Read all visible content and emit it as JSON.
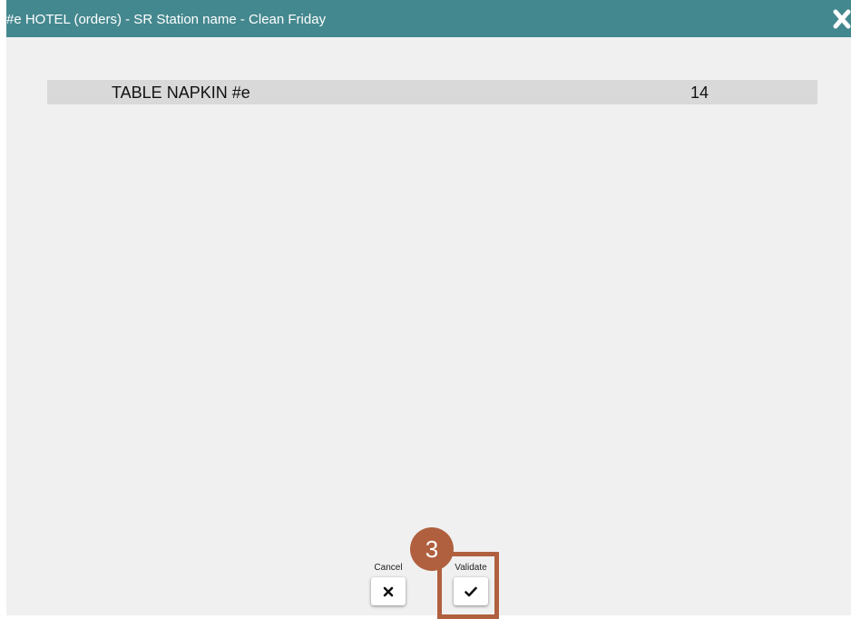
{
  "dialog": {
    "title": "#e HOTEL (orders) - SR Station name - Clean Friday",
    "close_icon": "close-icon",
    "header_color": "#44888f"
  },
  "items": [
    {
      "name": "TABLE NAPKIN #e",
      "quantity": "14"
    }
  ],
  "actions": {
    "cancel_label": "Cancel",
    "cancel_icon": "x-icon",
    "validate_label": "Validate",
    "validate_icon": "checkmark-icon"
  },
  "annotation": {
    "step_number": "3",
    "color": "#b0603f"
  }
}
